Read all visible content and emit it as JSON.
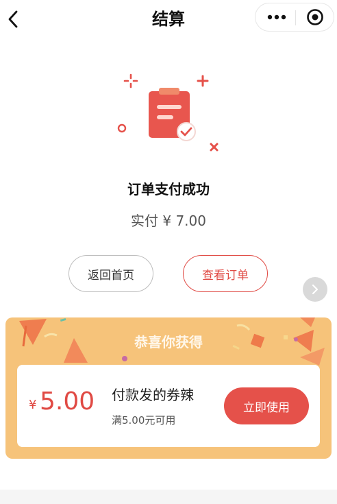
{
  "nav": {
    "title": "结算",
    "back_icon": "chevron-left-icon",
    "more_icon": "more-dots-icon",
    "close_icon": "target-circle-icon"
  },
  "result": {
    "title": "订单支付成功",
    "paid_text": "实付 ¥ 7.00",
    "illustration_icon": "clipboard-check-icon"
  },
  "actions": {
    "home_label": "返回首页",
    "order_label": "查看订单"
  },
  "reward": {
    "title": "恭喜你获得",
    "coupon": {
      "currency": "¥",
      "amount": "5.00",
      "name": "付款发的券辣",
      "condition": "满5.00元可用",
      "use_label": "立即使用"
    }
  },
  "colors": {
    "accent": "#e04a44",
    "reward_bg": "#f6c37a",
    "button_bg": "#e5514a"
  }
}
